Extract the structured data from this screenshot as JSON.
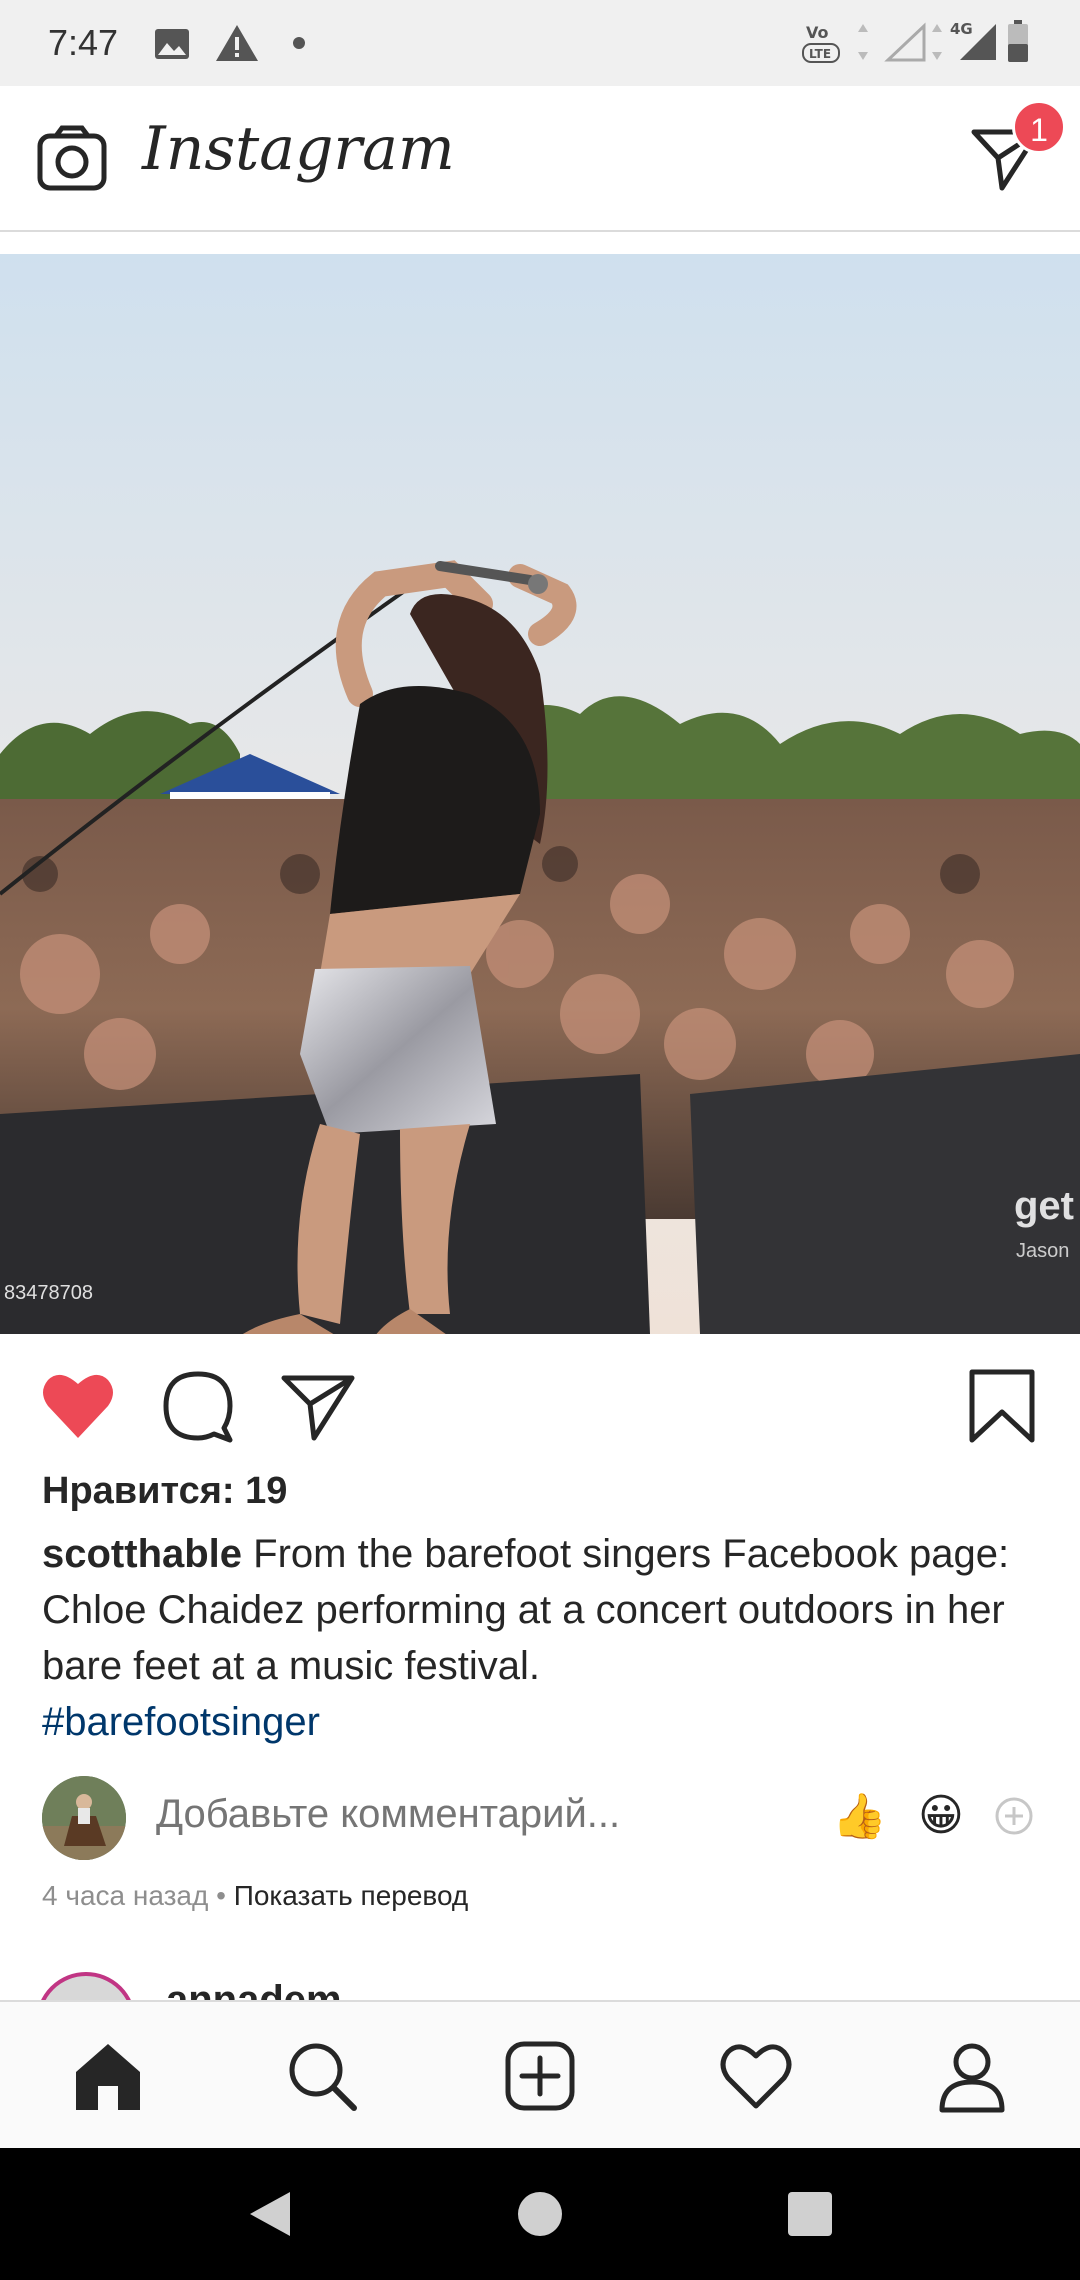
{
  "status_bar": {
    "time": "7:47",
    "icons": [
      "gallery-icon",
      "warning-icon",
      "dot-icon",
      "volte-icon",
      "signal-icon",
      "4g-signal-icon",
      "battery-icon"
    ],
    "network_label": "4G",
    "volte_label": "VoLTE"
  },
  "header": {
    "logo_text": "Instagram",
    "dm_badge_count": "1"
  },
  "post": {
    "image_description_icon": "concert-photo",
    "watermark_id": "83478708",
    "watermark_brand": "get",
    "watermark_sub": "Jason",
    "liked": true,
    "likes_text": "Нравится: 19",
    "username": "scotthable",
    "caption": "From the barefoot singers Facebook page: Chloe Chaidez performing at a concert outdoors in her bare feet at a music festival.",
    "hashtag": "#barefootsinger",
    "comment_placeholder": "Добавьте комментарий...",
    "quick_emojis": [
      "👍",
      "😀"
    ],
    "time_ago": "4 часа назад",
    "separator": " • ",
    "translate_label": "Показать перевод"
  },
  "next_post": {
    "username": "annadem"
  },
  "colors": {
    "like_red": "#ed4956",
    "hashtag_blue": "#00376b",
    "muted_gray": "#8e8e8e"
  }
}
